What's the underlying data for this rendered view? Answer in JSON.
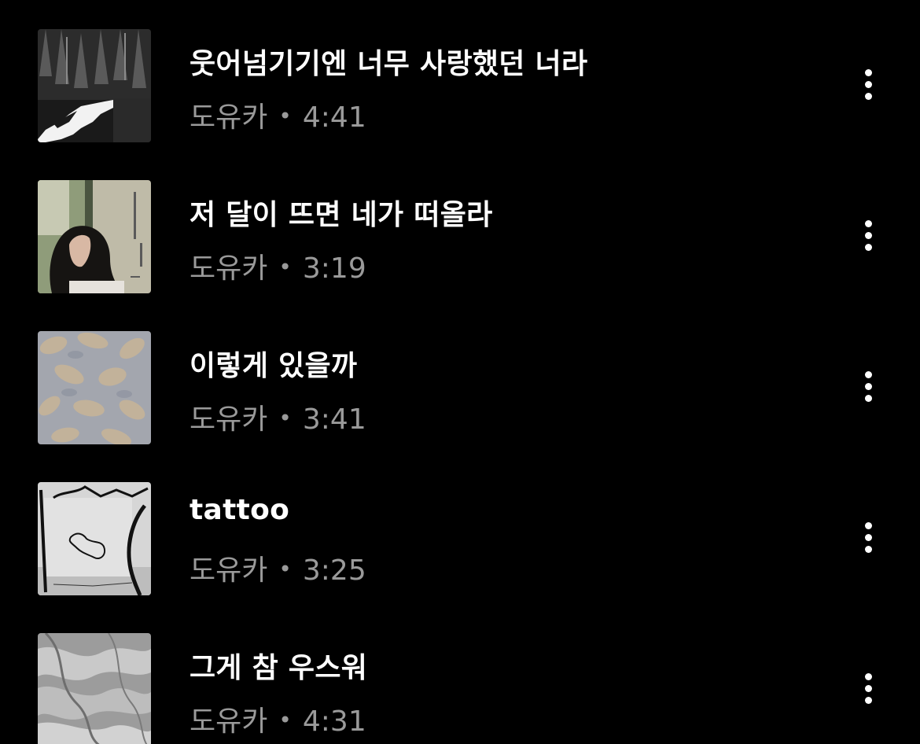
{
  "tracks": [
    {
      "title": "웃어넘기기엔 너무 사랑했던 너라",
      "artist": "도유카",
      "separator": "•",
      "duration": "4:41",
      "art_icon": "snowy-forest-art"
    },
    {
      "title": "저 달이 뜨면 네가 떠올라",
      "artist": "도유카",
      "separator": "•",
      "duration": "3:19",
      "art_icon": "portrait-woman-art"
    },
    {
      "title": "이렇게 있을까",
      "artist": "도유카",
      "separator": "•",
      "duration": "3:41",
      "art_icon": "petal-pattern-art"
    },
    {
      "title": "tattoo",
      "artist": "도유카",
      "separator": "•",
      "duration": "3:25",
      "art_icon": "sketch-hand-art"
    },
    {
      "title": "그게 참 우스워",
      "artist": "도유카",
      "separator": "•",
      "duration": "4:31",
      "art_icon": "silver-texture-art"
    }
  ],
  "colors": {
    "background": "#000000",
    "title": "#ffffff",
    "meta": "#9a9a9a",
    "menu_icon": "#ffffff"
  },
  "icons": {
    "more": "more-vertical-icon"
  }
}
